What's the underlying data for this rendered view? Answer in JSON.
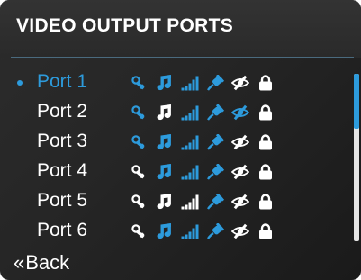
{
  "header": {
    "title": "VIDEO OUTPUT PORTS"
  },
  "ports": [
    {
      "label": "Port 1",
      "selected": true,
      "icon_colors": [
        "blue",
        "blue",
        "blue",
        "blue",
        "white",
        "white"
      ]
    },
    {
      "label": "Port 2",
      "selected": false,
      "icon_colors": [
        "blue",
        "white",
        "blue",
        "blue",
        "blue",
        "white"
      ]
    },
    {
      "label": "Port 3",
      "selected": false,
      "icon_colors": [
        "blue",
        "blue",
        "blue",
        "blue",
        "white",
        "white"
      ]
    },
    {
      "label": "Port 4",
      "selected": false,
      "icon_colors": [
        "white",
        "blue",
        "blue",
        "blue",
        "white",
        "white"
      ]
    },
    {
      "label": "Port 5",
      "selected": false,
      "icon_colors": [
        "white",
        "white",
        "white",
        "blue",
        "white",
        "white"
      ]
    },
    {
      "label": "Port 6",
      "selected": false,
      "icon_colors": [
        "white",
        "blue",
        "blue",
        "blue",
        "white",
        "white"
      ]
    }
  ],
  "status_icons": [
    "key-icon",
    "music-note-icon",
    "signal-bars-icon",
    "power-plug-icon",
    "eye-slash-icon",
    "lock-icon"
  ],
  "scrollbar": {
    "visible_fraction": 0.33,
    "position_fraction": 0
  },
  "footer": {
    "back_label": "Back",
    "back_icon": "«"
  },
  "colors": {
    "accent": "#2d9bdc",
    "text": "#ffffff",
    "background": "#262626"
  }
}
